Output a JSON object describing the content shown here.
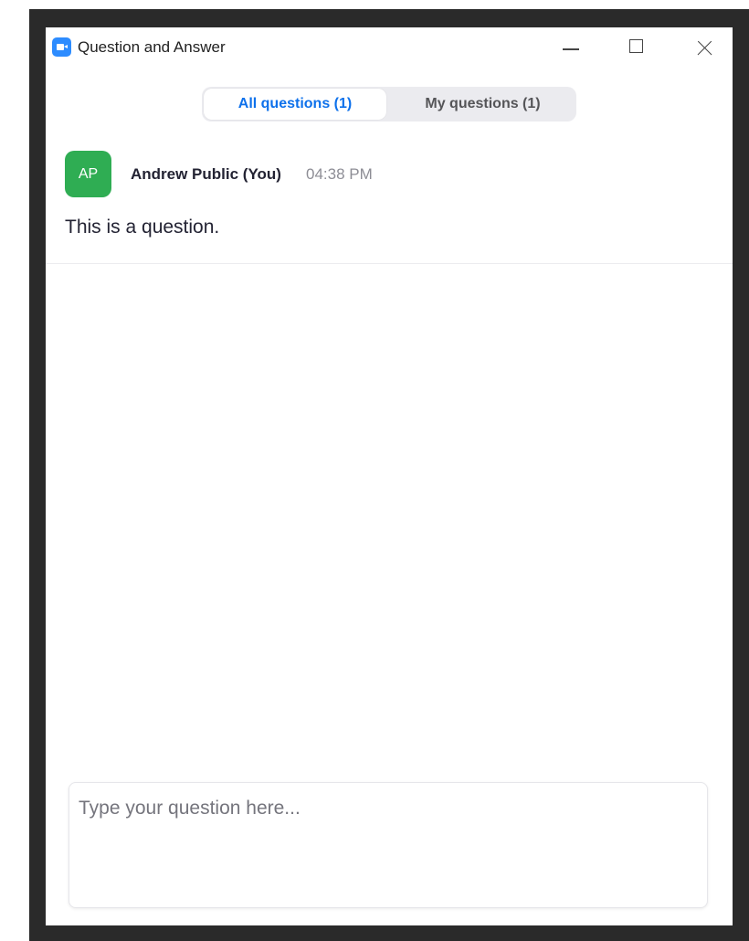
{
  "window": {
    "title": "Question and Answer",
    "controls": {
      "minimize": "minimize",
      "maximize": "maximize",
      "close": "close"
    }
  },
  "tabs": [
    {
      "label": "All questions (1)",
      "selected": true
    },
    {
      "label": "My questions (1)",
      "selected": false
    }
  ],
  "questions": [
    {
      "avatar_initials": "AP",
      "author": "Andrew Public (You)",
      "time": "04:38 PM",
      "text": "This is a question."
    }
  ],
  "composer": {
    "placeholder": "Type your question here...",
    "value": ""
  },
  "colors": {
    "accent": "#0e71eb",
    "avatar": "#2fad53",
    "app_icon": "#2d8cff",
    "frame": "#2a2a2a"
  },
  "icons": {
    "app": "zoom-camera-icon",
    "minimize": "minimize-icon",
    "maximize": "maximize-icon",
    "close": "close-icon"
  }
}
